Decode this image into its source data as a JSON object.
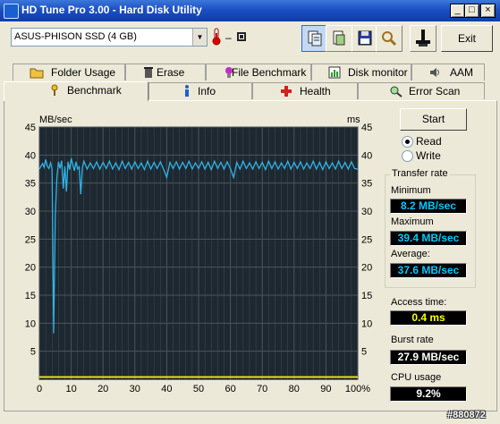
{
  "window": {
    "title": "HD Tune Pro 3.00 - Hard Disk Utility"
  },
  "toolbar": {
    "drive": "ASUS-PHISON SSD (4 GB)",
    "temperature": "–",
    "exit_label": "Exit"
  },
  "tabs_top": [
    {
      "label": "Folder Usage",
      "icon": "folder-icon"
    },
    {
      "label": "Erase",
      "icon": "trash-icon"
    },
    {
      "label": "File Benchmark",
      "icon": "file-benchmark-icon"
    },
    {
      "label": "Disk monitor",
      "icon": "monitor-chart-icon"
    },
    {
      "label": "AAM",
      "icon": "speaker-icon"
    }
  ],
  "tabs_bottom": [
    {
      "label": "Benchmark",
      "icon": "benchmark-icon",
      "active": true
    },
    {
      "label": "Info",
      "icon": "info-icon"
    },
    {
      "label": "Health",
      "icon": "health-cross-icon"
    },
    {
      "label": "Error Scan",
      "icon": "magnifier-icon"
    }
  ],
  "benchmark": {
    "start_label": "Start",
    "read_label": "Read",
    "write_label": "Write",
    "mode_selected": "Read",
    "transfer_group": "Transfer rate",
    "minimum_label": "Minimum",
    "minimum": "8.2 MB/sec",
    "maximum_label": "Maximum",
    "maximum": "39.4 MB/sec",
    "average_label": "Average:",
    "average": "37.6 MB/sec",
    "access_label": "Access time:",
    "access": "0.4 ms",
    "burst_label": "Burst rate",
    "burst": "27.9 MB/sec",
    "cpu_label": "CPU usage",
    "cpu": "9.2%"
  },
  "watermark": "#880872",
  "chart_data": {
    "type": "line",
    "ylabel_left": "MB/sec",
    "ylabel_right": "ms",
    "yticks": [
      5,
      10,
      15,
      20,
      25,
      30,
      35,
      40,
      45
    ],
    "xticks": [
      "0",
      "10",
      "20",
      "30",
      "40",
      "50",
      "60",
      "70",
      "80",
      "90",
      "100%"
    ],
    "ylim": [
      0,
      45
    ],
    "xlim": [
      0,
      100
    ],
    "grid": true,
    "colors": {
      "background": "#1e2830",
      "grid": "#4a5560",
      "transfer": "#2fb4e8",
      "access": "#e8e020"
    },
    "series": [
      {
        "key": "transfer",
        "x": [
          0,
          1,
          1.5,
          2,
          2.5,
          3,
          3.5,
          4,
          4.5,
          5,
          5.5,
          6,
          6.5,
          7,
          7.5,
          8,
          8.5,
          9,
          9.5,
          10,
          11,
          11.5,
          12,
          12.5,
          13,
          13.5,
          14,
          15,
          16,
          17,
          18,
          19,
          20,
          21,
          22,
          23,
          24,
          25,
          26,
          27,
          28,
          29,
          30,
          31,
          32,
          33,
          34,
          35,
          36,
          37,
          38,
          39,
          40,
          41,
          42,
          43,
          44,
          45,
          46,
          47,
          48,
          49,
          50,
          51,
          52,
          53,
          54,
          55,
          56,
          57,
          58,
          59,
          60,
          61,
          62,
          63,
          64,
          65,
          66,
          67,
          68,
          69,
          70,
          71,
          72,
          73,
          74,
          75,
          76,
          77,
          78,
          79,
          80,
          81,
          82,
          83,
          84,
          85,
          86,
          87,
          88,
          89,
          90,
          91,
          92,
          93,
          94,
          95,
          96,
          97,
          98,
          99,
          100
        ],
        "y": [
          37.5,
          38.5,
          37.8,
          39.2,
          38.0,
          37.6,
          38.6,
          37.5,
          8.2,
          29.0,
          36.0,
          38.8,
          37.6,
          39.0,
          34.0,
          38.0,
          33.5,
          38.8,
          37.4,
          39.4,
          37.2,
          38.8,
          37.5,
          37.9,
          33.0,
          37.8,
          38.9,
          37.5,
          38.6,
          37.6,
          38.8,
          37.5,
          38.7,
          37.6,
          38.9,
          37.5,
          38.6,
          37.4,
          38.9,
          37.6,
          38.7,
          37.5,
          38.8,
          37.6,
          38.6,
          37.4,
          38.9,
          37.5,
          38.7,
          37.6,
          38.8,
          37.5,
          36.0,
          38.7,
          37.6,
          38.8,
          37.5,
          38.7,
          37.6,
          38.9,
          37.5,
          38.6,
          37.6,
          38.8,
          37.5,
          38.7,
          37.4,
          38.9,
          37.6,
          38.7,
          37.5,
          38.8,
          37.6,
          36.0,
          38.7,
          37.5,
          38.9,
          37.6,
          38.6,
          37.5,
          38.8,
          37.6,
          38.7,
          37.4,
          38.9,
          37.6,
          38.8,
          37.5,
          38.6,
          37.6,
          38.9,
          37.5,
          38.7,
          37.6,
          38.8,
          37.5,
          38.6,
          37.6,
          38.9,
          37.5,
          38.7,
          37.4,
          38.8,
          37.6,
          38.6,
          37.5,
          38.9,
          37.6,
          38.7,
          37.5,
          38.8,
          37.6,
          37.5
        ]
      },
      {
        "key": "access",
        "x": [
          0,
          10,
          20,
          30,
          40,
          50,
          60,
          70,
          80,
          90,
          100
        ],
        "y": [
          0.4,
          0.4,
          0.4,
          0.4,
          0.4,
          0.4,
          0.4,
          0.4,
          0.4,
          0.4,
          0.4
        ]
      }
    ]
  }
}
